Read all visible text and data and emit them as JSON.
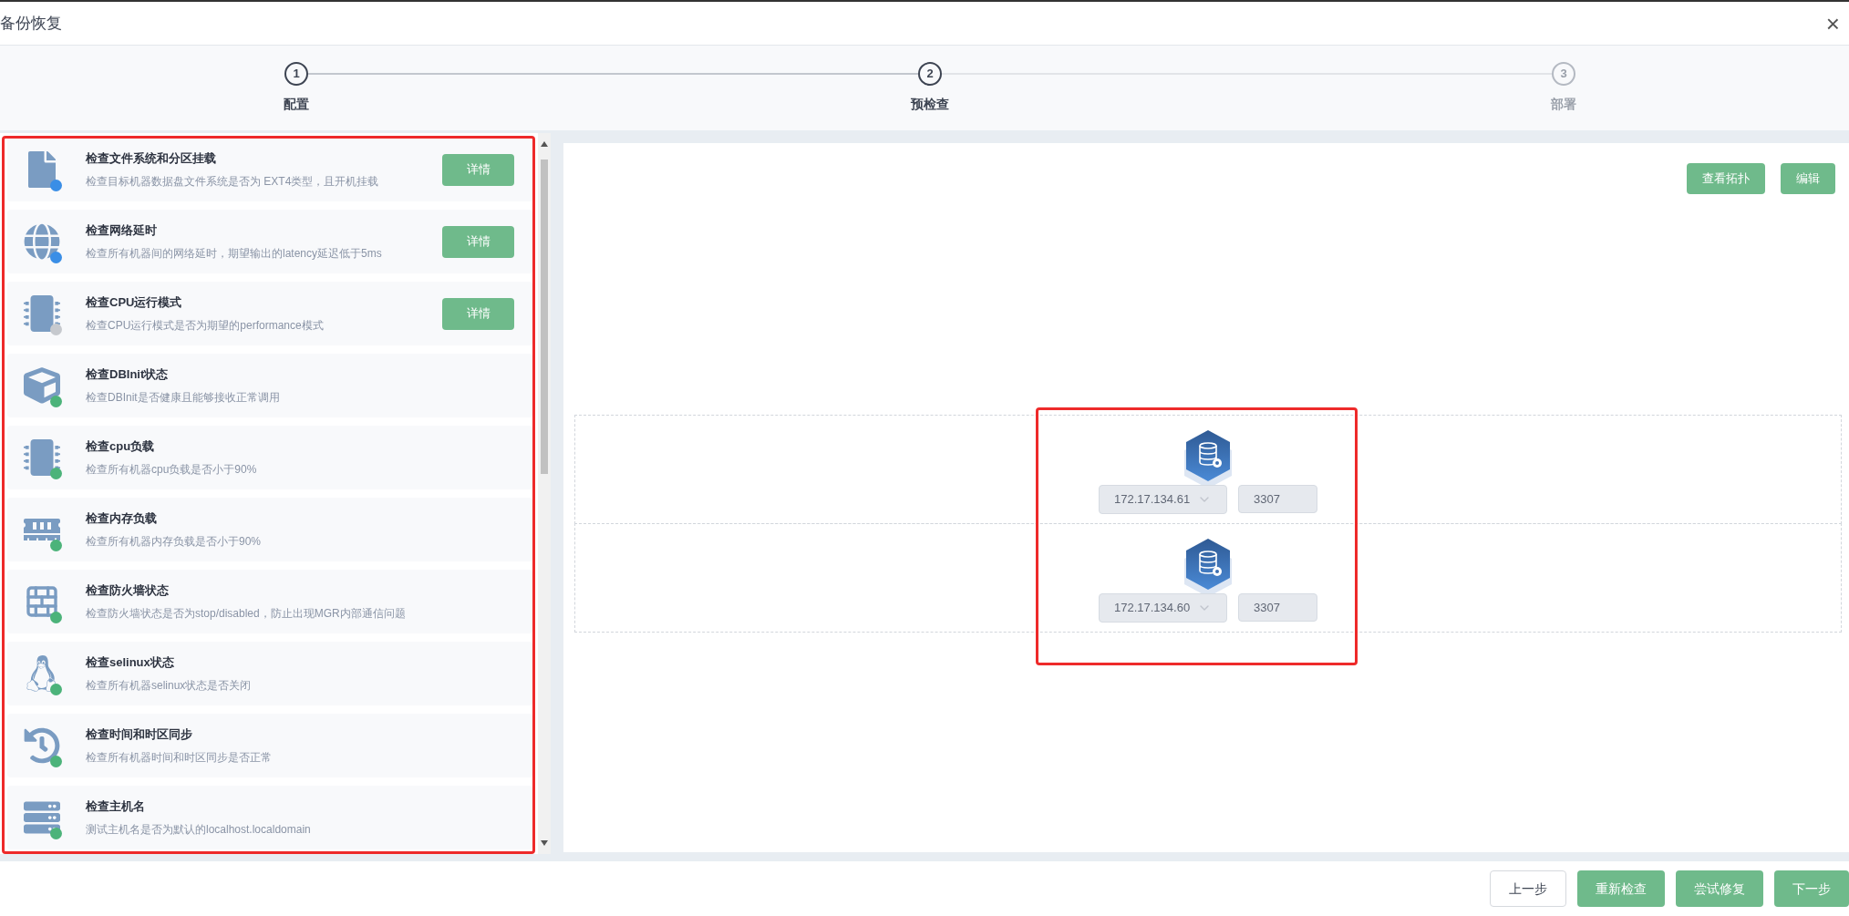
{
  "window": {
    "title": "备份恢复",
    "close": "×"
  },
  "steps": [
    {
      "number": "1",
      "label": "配置",
      "disabled": false
    },
    {
      "number": "2",
      "label": "预检查",
      "disabled": false
    },
    {
      "number": "3",
      "label": "部署",
      "disabled": true
    }
  ],
  "checks": [
    {
      "kind": "file",
      "color": "#3a8ee6",
      "title": "检查文件系统和分区挂载",
      "description": "检查目标机器数据盘文件系统是否为 EXT4类型，且开机挂载",
      "action": "详情"
    },
    {
      "kind": "globe",
      "color": "#3a8ee6",
      "title": "检查网络延时",
      "description": "检查所有机器间的网络延时，期望输出的latency延迟低于5ms",
      "action": "详情"
    },
    {
      "kind": "cpu",
      "color": "#c6c9ce",
      "title": "检查CPU运行模式",
      "description": "检查CPU运行模式是否为期望的performance模式",
      "action": "详情"
    },
    {
      "kind": "cube",
      "color": "#4cb37a",
      "title": "检查DBInit状态",
      "description": "检查DBInit是否健康且能够接收正常调用"
    },
    {
      "kind": "cpu",
      "color": "#4cb37a",
      "title": "检查cpu负载",
      "description": "检查所有机器cpu负载是否小于90%"
    },
    {
      "kind": "memory",
      "color": "#4cb37a",
      "title": "检查内存负载",
      "description": "检查所有机器内存负载是否小于90%"
    },
    {
      "kind": "firewall",
      "color": "#4cb37a",
      "title": "检查防火墙状态",
      "description": "检查防火墙状态是否为stop/disabled，防止出现MGR内部通信问题"
    },
    {
      "kind": "linux",
      "color": "#4cb37a",
      "title": "检查selinux状态",
      "description": "检查所有机器selinux状态是否关闭"
    },
    {
      "kind": "clock",
      "color": "#4cb37a",
      "title": "检查时间和时区同步",
      "description": "检查所有机器时间和时区同步是否正常"
    },
    {
      "kind": "server",
      "color": "#4cb37a",
      "title": "检查主机名",
      "description": "测试主机名是否为默认的localhost.localdomain"
    }
  ],
  "topology": {
    "buttons": [
      "查看拓扑",
      "编辑"
    ],
    "nodes": [
      {
        "host": "172.17.134.61",
        "port": "3307"
      },
      {
        "host": "172.17.134.60",
        "port": "3307"
      }
    ]
  },
  "footer": {
    "buttons": [
      {
        "label": "上一步",
        "kind": "plain"
      },
      {
        "label": "重新检查",
        "kind": "primary"
      },
      {
        "label": "尝试修复",
        "kind": "primary"
      },
      {
        "label": "下一步",
        "kind": "primary"
      }
    ]
  }
}
